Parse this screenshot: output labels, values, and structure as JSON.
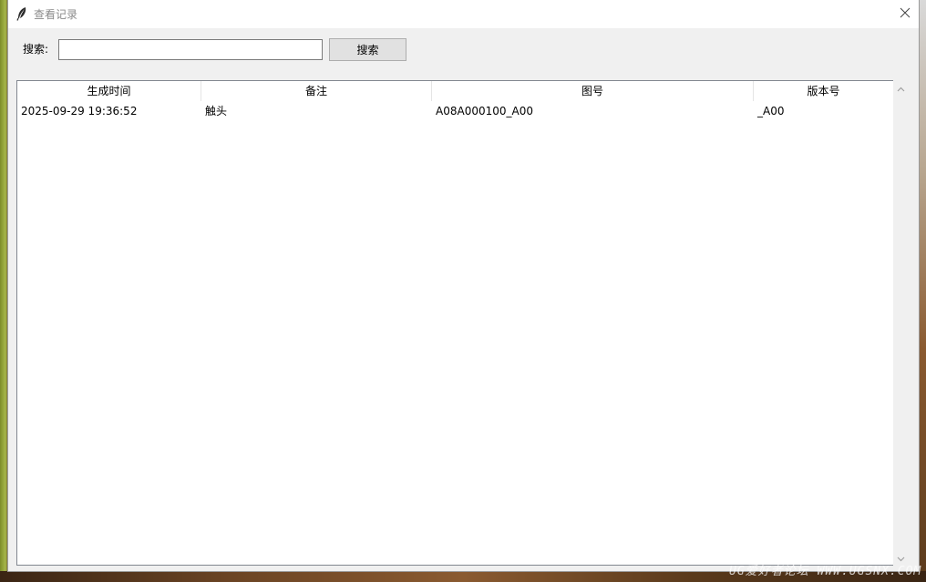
{
  "window": {
    "title": "查看记录"
  },
  "search": {
    "label": "搜索:",
    "value": "",
    "placeholder": "",
    "button_label": "搜索"
  },
  "table": {
    "columns": [
      "生成时间",
      "备注",
      "图号",
      "版本号"
    ],
    "rows": [
      [
        "2025-09-29 19:36:52",
        "触头",
        "A08A000100_A00",
        "_A00"
      ]
    ]
  },
  "watermark": "UG爱好者论坛 WWW.UGSNX.COM",
  "icons": {
    "app": "feather-icon",
    "close": "close-icon",
    "scroll_up": "chevron-up-icon",
    "scroll_down": "chevron-down-icon"
  }
}
